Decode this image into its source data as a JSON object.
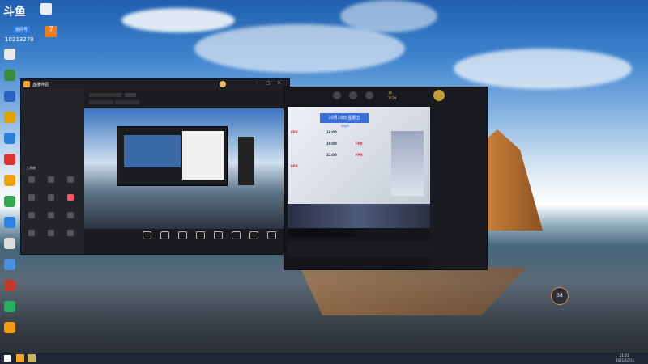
{
  "stream_overlay": {
    "logo": "斗鱼",
    "sub": "房间号",
    "room": "10213278",
    "badge": "7"
  },
  "desktop_icons": [
    {
      "label": "",
      "color": "#e8e8e8"
    },
    {
      "label": "",
      "color": "#3c8a3b"
    },
    {
      "label": "",
      "color": "#2b62c3"
    },
    {
      "label": "",
      "color": "#e0a200"
    },
    {
      "label": "",
      "color": "#2a7fd8"
    },
    {
      "label": "",
      "color": "#d33"
    },
    {
      "label": "",
      "color": "#eba314"
    },
    {
      "label": "",
      "color": "#34a853"
    },
    {
      "label": "",
      "color": "#2c82e2"
    },
    {
      "label": "",
      "color": "#dcdcdc"
    },
    {
      "label": "",
      "color": "#4a90e2"
    },
    {
      "label": "",
      "color": "#c0392b"
    },
    {
      "label": "",
      "color": "#27ae60"
    },
    {
      "label": "",
      "color": "#f39c12"
    }
  ],
  "live_app": {
    "title": "直播伴侣",
    "tabs": [
      "",
      ""
    ],
    "side_label": "工具箱",
    "tools": [
      "",
      "",
      "",
      "",
      "",
      "",
      "",
      "",
      "",
      "",
      "",
      ""
    ],
    "bottom_buttons": [
      "",
      "",
      "",
      "",
      "",
      "",
      "",
      ""
    ],
    "status": ""
  },
  "game": {
    "date_title": "10月15日 星期五",
    "day": "day6",
    "matches": [
      {
        "team_a": "FPX",
        "time": "16:00",
        "team_b": ""
      },
      {
        "team_a": "",
        "time": "19:00",
        "team_b": "FPX"
      },
      {
        "team_a": "",
        "time": "22:00",
        "team_b": "FPX"
      },
      {
        "team_a": "FPX",
        "time": "",
        "team_b": ""
      }
    ],
    "times": [
      "22:00",
      "22:00"
    ],
    "news_title": "",
    "stats": {
      "a": "16",
      "b": "1524"
    },
    "friends": [
      "",
      "",
      ""
    ]
  },
  "taskbar": {
    "time": "11:01",
    "date": "2021/10/15"
  },
  "ball_value": "38"
}
